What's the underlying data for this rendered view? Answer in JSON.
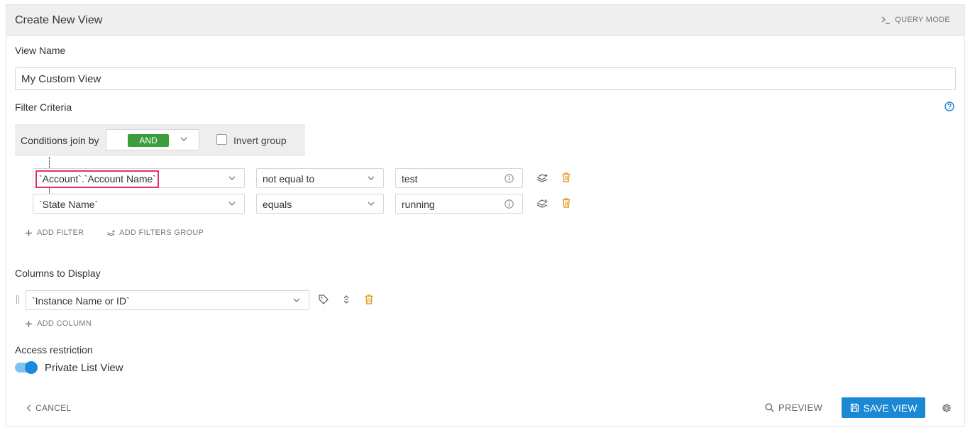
{
  "header": {
    "title": "Create New View",
    "query_mode_label": "QUERY MODE"
  },
  "view_name": {
    "label": "View Name",
    "value": "My Custom View"
  },
  "filter_criteria": {
    "label": "Filter Criteria",
    "conditions_join_label": "Conditions join by",
    "join_value": "AND",
    "invert_group_label": "Invert group",
    "invert_checked": false,
    "rows": [
      {
        "field": "`Account`.`Account Name`",
        "operator": "not equal to",
        "value": "test"
      },
      {
        "field": "`State Name`",
        "operator": "equals",
        "value": "running"
      }
    ],
    "add_filter_label": "ADD FILTER",
    "add_group_label": "ADD FILTERS GROUP"
  },
  "columns": {
    "label": "Columns to Display",
    "items": [
      {
        "field": "`Instance Name or ID`"
      }
    ],
    "add_column_label": "ADD COLUMN"
  },
  "access": {
    "label": "Access restriction",
    "toggle_label": "Private List View",
    "toggle_on": true
  },
  "footer": {
    "cancel_label": "CANCEL",
    "preview_label": "PREVIEW",
    "save_label": "SAVE VIEW"
  },
  "colors": {
    "accent": "#1a88d4",
    "and_green": "#3c9d3c",
    "trash_orange": "#e89a2a",
    "highlight": "#e0316c"
  }
}
